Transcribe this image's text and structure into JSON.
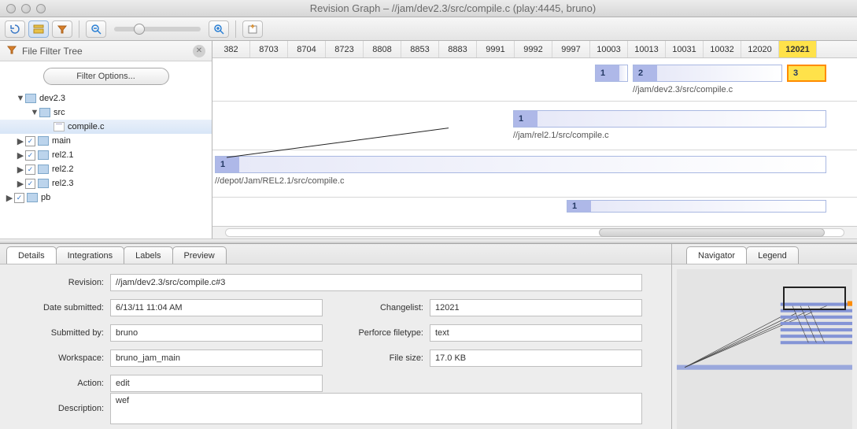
{
  "window": {
    "title": "Revision Graph – //jam/dev2.3/src/compile.c (play:4445, bruno)"
  },
  "filter": {
    "title": "File Filter Tree",
    "options_btn": "Filter Options..."
  },
  "tree": {
    "dev23": "dev2.3",
    "src": "src",
    "compile": "compile.c",
    "main": "main",
    "rel21": "rel2.1",
    "rel22": "rel2.2",
    "rel23": "rel2.3",
    "pb": "pb"
  },
  "ruler": [
    "382",
    "8703",
    "8704",
    "8723",
    "8808",
    "8853",
    "8883",
    "9991",
    "9992",
    "9997",
    "10003",
    "10013",
    "10031",
    "10032",
    "12020",
    "12021"
  ],
  "graph": {
    "row0_rev2": "2",
    "row0_rev1": "1",
    "row0_rev3": "3",
    "row0_path": "//jam/dev2.3/src/compile.c",
    "row1_rev1": "1",
    "row1_path": "//jam/rel2.1/src/compile.c",
    "row2_rev1": "1",
    "row2_path": "//depot/Jam/REL2.1/src/compile.c",
    "row3_rev1": "1"
  },
  "tabs_left": [
    "Details",
    "Integrations",
    "Labels",
    "Preview"
  ],
  "tabs_right": [
    "Navigator",
    "Legend"
  ],
  "details": {
    "revision_lbl": "Revision:",
    "revision": "//jam/dev2.3/src/compile.c#3",
    "date_lbl": "Date submitted:",
    "date": "6/13/11 11:04 AM",
    "changelist_lbl": "Changelist:",
    "changelist": "12021",
    "submittedby_lbl": "Submitted by:",
    "submittedby": "bruno",
    "filetype_lbl": "Perforce filetype:",
    "filetype": "text",
    "workspace_lbl": "Workspace:",
    "workspace": "bruno_jam_main",
    "filesize_lbl": "File size:",
    "filesize": "17.0 KB",
    "action_lbl": "Action:",
    "action": "edit",
    "description_lbl": "Description:",
    "description": "wef"
  }
}
